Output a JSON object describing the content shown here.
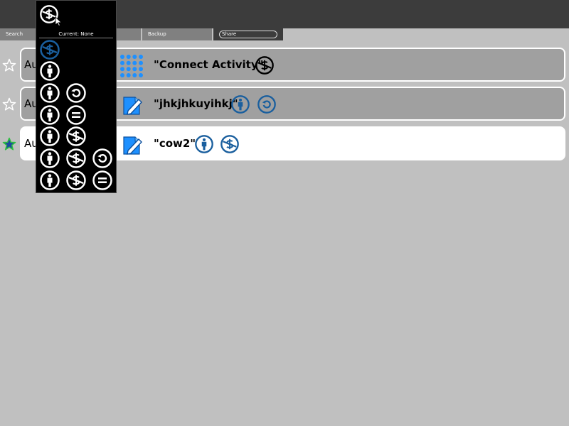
{
  "toolbar": {
    "search_label": "Search",
    "backup_label": "Backup",
    "share_placeholder": "Share"
  },
  "entries": [
    {
      "author": "Au",
      "title": "\"Connect Activity\"",
      "starred": false,
      "activity_icon": "grid-dots-icon",
      "licenses": [
        "cc-nc-icon"
      ]
    },
    {
      "author": "Au",
      "title": "\"jhkjhkuyihkj\"",
      "starred": false,
      "activity_icon": "write-document-icon",
      "licenses": [
        "cc-by-icon",
        "cc-sa-icon"
      ]
    },
    {
      "author": "Au",
      "title": "\"cow2\"",
      "starred": true,
      "activity_icon": "write-document-icon",
      "licenses": [
        "cc-by-icon",
        "cc-nc-icon"
      ]
    }
  ],
  "license_palette": {
    "current_label": "Current: None",
    "rows": [
      [
        "cc-nc-icon"
      ],
      [
        "cc-by-icon"
      ],
      [
        "cc-by-icon",
        "cc-sa-icon"
      ],
      [
        "cc-by-icon",
        "cc-nd-icon"
      ],
      [
        "cc-by-icon",
        "cc-nc-icon"
      ],
      [
        "cc-by-icon",
        "cc-nc-icon",
        "cc-sa-icon"
      ],
      [
        "cc-by-icon",
        "cc-nc-icon",
        "cc-nd-icon"
      ]
    ]
  },
  "colors": {
    "top_bar": "#3c3c3c",
    "toolbar_tab": "#808080",
    "row_bg": "#a0a0a0",
    "row_selected": "#ffffff",
    "license_blue": "#1a5f9e",
    "activity_blue": "#1e90ff",
    "star_fill": "#1e4aa0",
    "star_stroke": "#2ec040"
  }
}
